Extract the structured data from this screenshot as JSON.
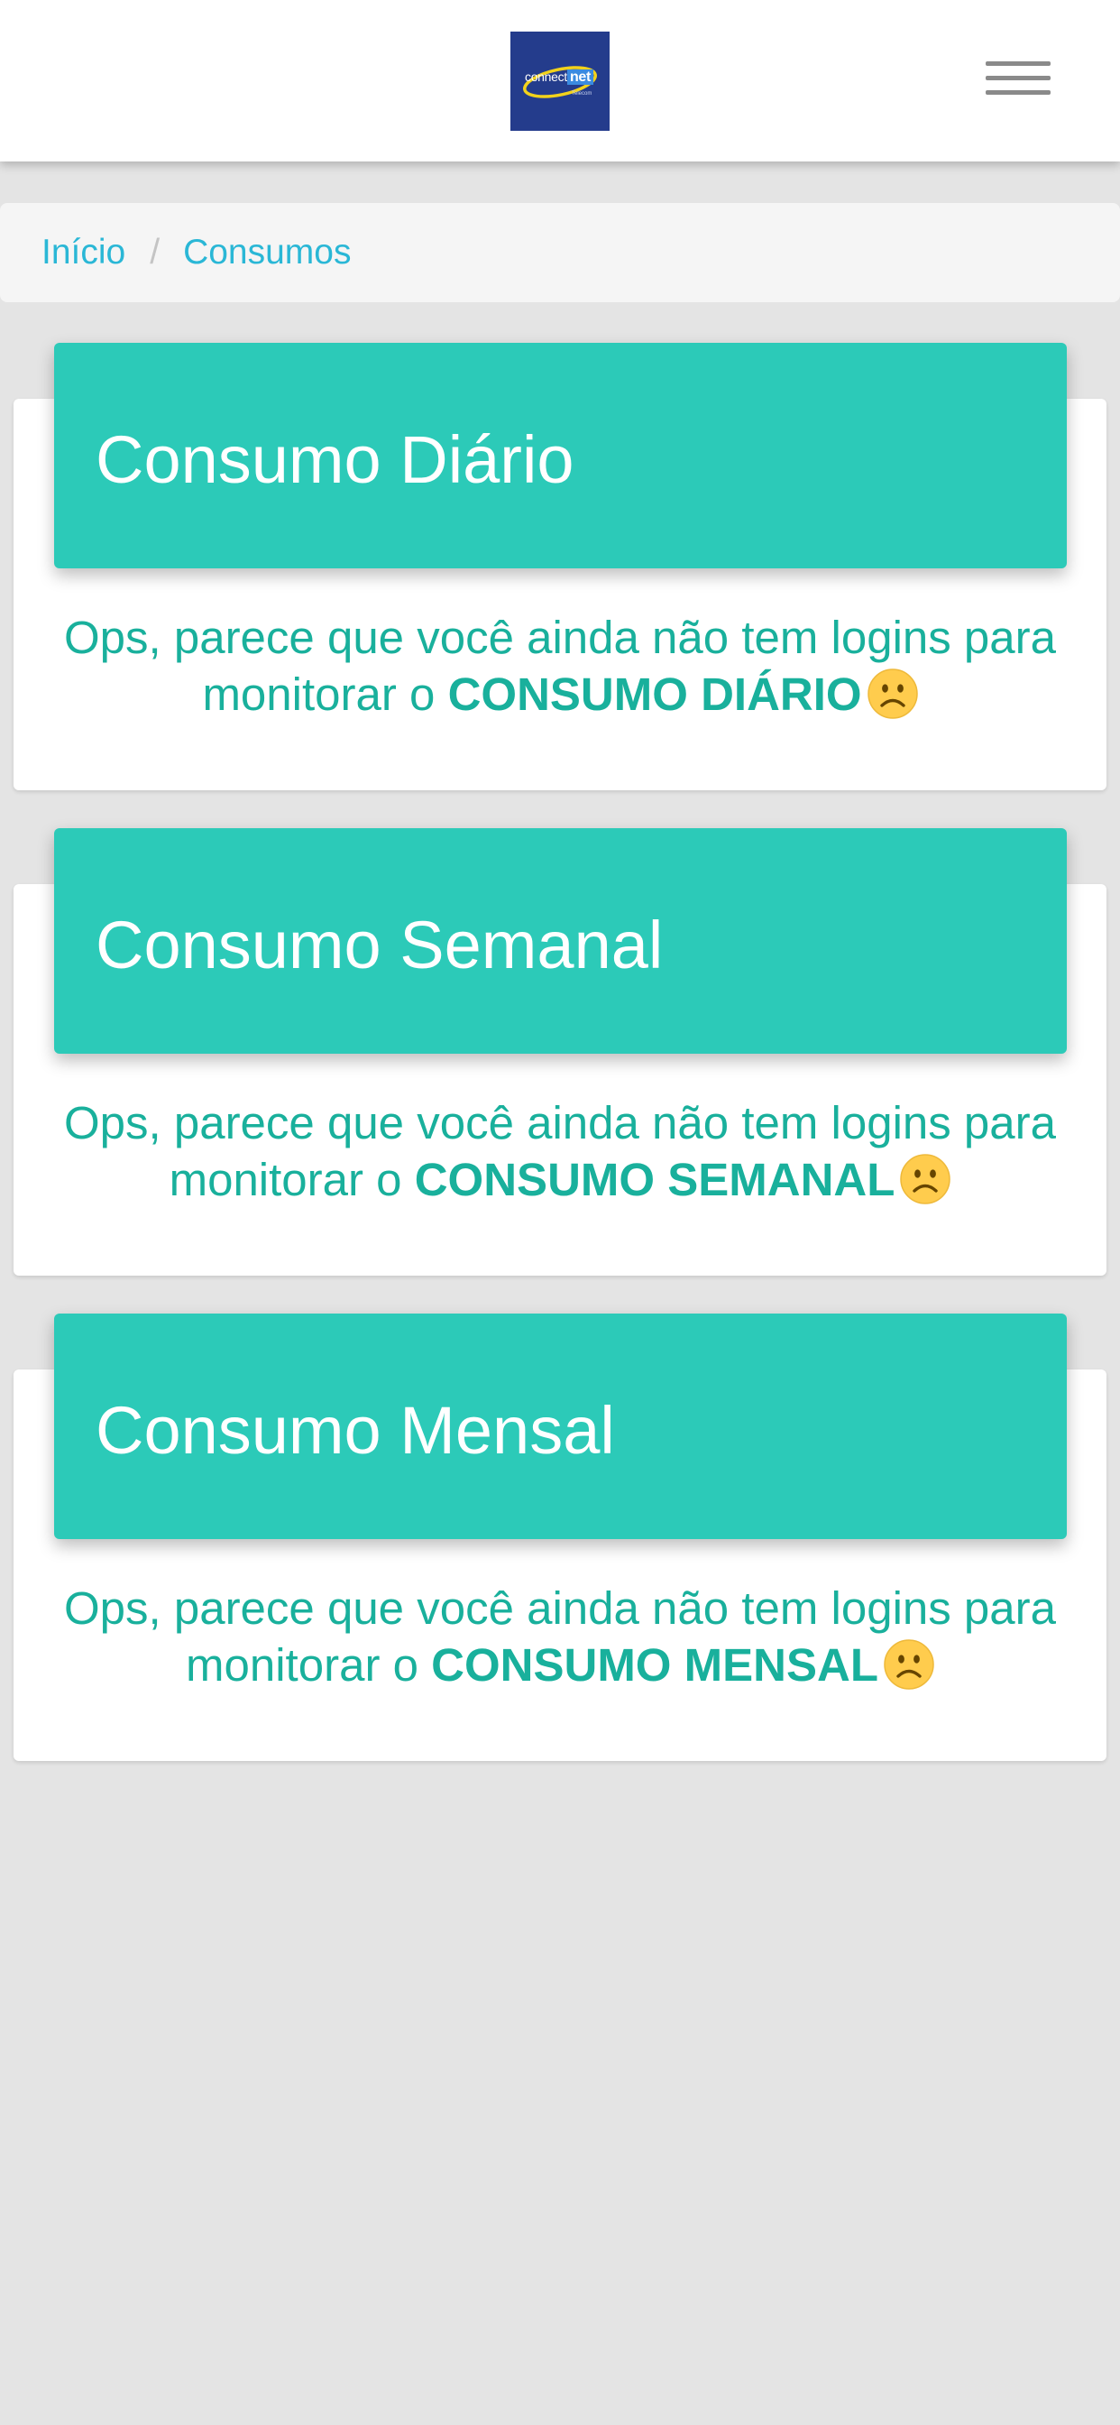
{
  "header": {
    "logo_word_1": "connect",
    "logo_word_2": "net",
    "logo_sub": "Telecom",
    "menu_icon": "hamburger-menu-icon"
  },
  "breadcrumb": {
    "home": "Início",
    "separator": "/",
    "current": "Consumos"
  },
  "cards": [
    {
      "title": "Consumo Diário",
      "message_line1": "Ops, parece que você ainda não tem logins para",
      "message_prefix": "monitorar o",
      "message_bold": "CONSUMO DIÁRIO",
      "icon": "sad-face-icon"
    },
    {
      "title": "Consumo Semanal",
      "message_line1": "Ops, parece que você ainda não tem logins para",
      "message_prefix": "monitorar o",
      "message_bold": "CONSUMO SEMANAL",
      "icon": "sad-face-icon"
    },
    {
      "title": "Consumo Mensal",
      "message_line1": "Ops, parece que você ainda não tem logins para",
      "message_prefix": "monitorar o",
      "message_bold": "CONSUMO MENSAL",
      "icon": "sad-face-icon"
    }
  ],
  "colors": {
    "accent": "#2ccab8",
    "text_accent": "#19b09c",
    "link": "#2ab7d6",
    "logo_bg": "#243c8c",
    "background": "#e4e4e4"
  }
}
